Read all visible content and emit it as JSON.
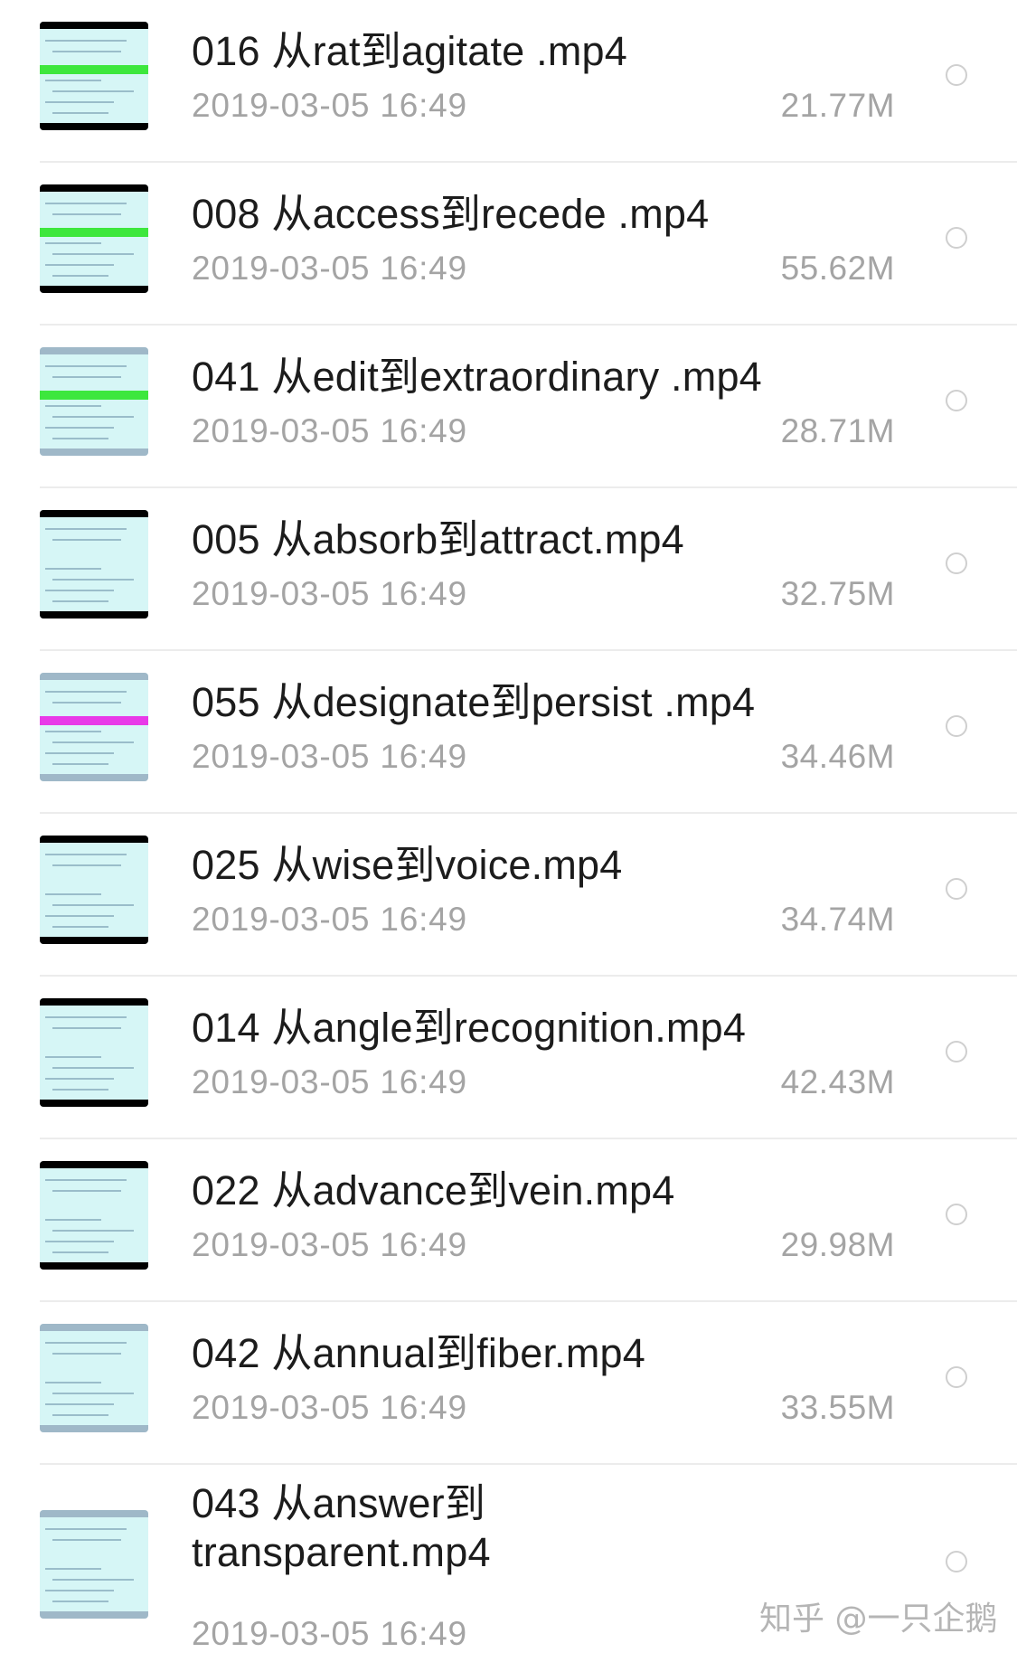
{
  "files": [
    {
      "title": "016 从rat到agitate .mp4",
      "date": "2019-03-05 16:49",
      "size": "21.77M",
      "thumb_bars": "#000000",
      "thumb_highlight": "#3de73d"
    },
    {
      "title": "008 从access到recede .mp4",
      "date": "2019-03-05 16:49",
      "size": "55.62M",
      "thumb_bars": "#000000",
      "thumb_highlight": "#3de73d"
    },
    {
      "title": "041 从edit到extraordinary .mp4",
      "date": "2019-03-05 16:49",
      "size": "28.71M",
      "thumb_bars": "#9fb8c8",
      "thumb_highlight": "#3de73d"
    },
    {
      "title": "005 从absorb到attract.mp4",
      "date": "2019-03-05 16:49",
      "size": "32.75M",
      "thumb_bars": "#000000",
      "thumb_highlight": ""
    },
    {
      "title": "055 从designate到persist .mp4",
      "date": "2019-03-05 16:49",
      "size": "34.46M",
      "thumb_bars": "#9fb8c8",
      "thumb_highlight": "#e83ae8"
    },
    {
      "title": "025 从wise到voice.mp4",
      "date": "2019-03-05 16:49",
      "size": "34.74M",
      "thumb_bars": "#000000",
      "thumb_highlight": ""
    },
    {
      "title": "014 从angle到recognition.mp4",
      "date": "2019-03-05 16:49",
      "size": "42.43M",
      "thumb_bars": "#000000",
      "thumb_highlight": ""
    },
    {
      "title": "022 从advance到vein.mp4",
      "date": "2019-03-05 16:49",
      "size": "29.98M",
      "thumb_bars": "#000000",
      "thumb_highlight": ""
    },
    {
      "title": "042 从annual到fiber.mp4",
      "date": "2019-03-05 16:49",
      "size": "33.55M",
      "thumb_bars": "#9fb8c8",
      "thumb_highlight": ""
    },
    {
      "title": "043 从answer到transparent.mp4",
      "date": "2019-03-05 16:49",
      "size": "",
      "thumb_bars": "#9fb8c8",
      "thumb_highlight": ""
    }
  ],
  "watermark": "知乎 @一只企鹅"
}
